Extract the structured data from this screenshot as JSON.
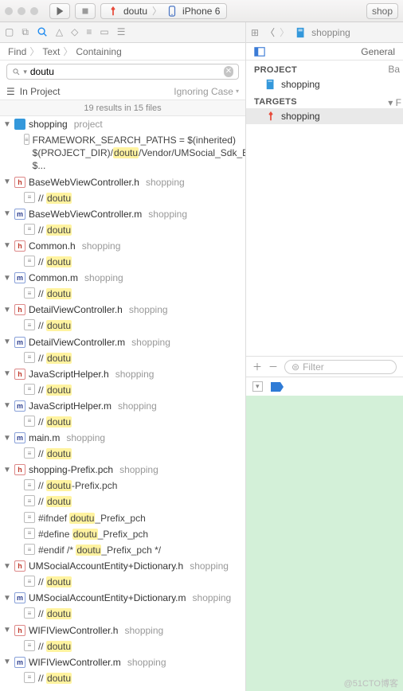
{
  "toolbar": {
    "scheme_target": "doutu",
    "scheme_device": "iPhone 6",
    "right_cut": "shop"
  },
  "navigator_tabs": {
    "icons": [
      "nav-folder",
      "nav-hierarchy",
      "nav-search",
      "nav-warning",
      "nav-tests",
      "nav-debug",
      "nav-breakpoints",
      "nav-reports"
    ]
  },
  "jump_bar": {
    "root": "shopping"
  },
  "breadcrumb": {
    "a": "Find",
    "b": "Text",
    "c": "Containing"
  },
  "search": {
    "prefix_icon": "magnify",
    "query": "doutu",
    "scope_icon": "scope",
    "scope_label": "In Project",
    "ignoring": "Ignoring Case",
    "summary": "19 results in 15 files"
  },
  "right_panel": {
    "sidebar_toggle": "layout-icon",
    "tab_general": "General",
    "tab_cut": "Ba",
    "section_project": "PROJECT",
    "project_item": "shopping",
    "section_targets": "TARGETS",
    "target_item": "shopping",
    "filter_placeholder": "Filter",
    "dbg_detail_cut": "F"
  },
  "results": [
    {
      "type": "group",
      "icon": "proj",
      "name": "shopping",
      "note": "project",
      "lines": [
        {
          "pre": "FRAMEWORK_SEARCH_PATHS = $(inherited) $(PROJECT_DIR)/",
          "hl": "doutu",
          "post": "/Vendor/UMSocial_Sdk_Extra_Frameworks/TencentOpenAPI $..."
        }
      ]
    },
    {
      "type": "group",
      "icon": "h",
      "name": "BaseWebViewController.h",
      "note": "shopping",
      "lines": [
        {
          "pre": "//  ",
          "hl": "doutu",
          "post": ""
        }
      ]
    },
    {
      "type": "group",
      "icon": "m",
      "name": "BaseWebViewController.m",
      "note": "shopping",
      "lines": [
        {
          "pre": "//  ",
          "hl": "doutu",
          "post": ""
        }
      ]
    },
    {
      "type": "group",
      "icon": "h",
      "name": "Common.h",
      "note": "shopping",
      "lines": [
        {
          "pre": "//  ",
          "hl": "doutu",
          "post": ""
        }
      ]
    },
    {
      "type": "group",
      "icon": "m",
      "name": "Common.m",
      "note": "shopping",
      "lines": [
        {
          "pre": "//  ",
          "hl": "doutu",
          "post": ""
        }
      ]
    },
    {
      "type": "group",
      "icon": "h",
      "name": "DetailViewController.h",
      "note": "shopping",
      "lines": [
        {
          "pre": "//  ",
          "hl": "doutu",
          "post": ""
        }
      ]
    },
    {
      "type": "group",
      "icon": "m",
      "name": "DetailViewController.m",
      "note": "shopping",
      "lines": [
        {
          "pre": "//  ",
          "hl": "doutu",
          "post": ""
        }
      ]
    },
    {
      "type": "group",
      "icon": "h",
      "name": "JavaScriptHelper.h",
      "note": "shopping",
      "lines": [
        {
          "pre": "//  ",
          "hl": "doutu",
          "post": ""
        }
      ]
    },
    {
      "type": "group",
      "icon": "m",
      "name": "JavaScriptHelper.m",
      "note": "shopping",
      "lines": [
        {
          "pre": "//  ",
          "hl": "doutu",
          "post": ""
        }
      ]
    },
    {
      "type": "group",
      "icon": "m",
      "name": "main.m",
      "note": "shopping",
      "lines": [
        {
          "pre": "//  ",
          "hl": "doutu",
          "post": ""
        }
      ]
    },
    {
      "type": "group",
      "icon": "h",
      "name": "shopping-Prefix.pch",
      "note": "shopping",
      "lines": [
        {
          "pre": "//  ",
          "hl": "doutu",
          "post": "-Prefix.pch"
        },
        {
          "pre": "//  ",
          "hl": "doutu",
          "post": ""
        },
        {
          "pre": "#ifndef ",
          "hl": "doutu",
          "post": "_Prefix_pch"
        },
        {
          "pre": "#define ",
          "hl": "doutu",
          "post": "_Prefix_pch"
        },
        {
          "pre": "#endif /* ",
          "hl": "doutu",
          "post": "_Prefix_pch */"
        }
      ]
    },
    {
      "type": "group",
      "icon": "h",
      "name": "UMSocialAccountEntity+Dictionary.h",
      "note": "shopping",
      "lines": [
        {
          "pre": "//  ",
          "hl": "doutu",
          "post": ""
        }
      ]
    },
    {
      "type": "group",
      "icon": "m",
      "name": "UMSocialAccountEntity+Dictionary.m",
      "note": "shopping",
      "lines": [
        {
          "pre": "//  ",
          "hl": "doutu",
          "post": ""
        }
      ]
    },
    {
      "type": "group",
      "icon": "h",
      "name": "WIFIViewController.h",
      "note": "shopping",
      "lines": [
        {
          "pre": "//  ",
          "hl": "doutu",
          "post": ""
        }
      ]
    },
    {
      "type": "group",
      "icon": "m",
      "name": "WIFIViewController.m",
      "note": "shopping",
      "lines": [
        {
          "pre": "//  ",
          "hl": "doutu",
          "post": ""
        }
      ]
    }
  ],
  "watermark": "@51CTO博客"
}
